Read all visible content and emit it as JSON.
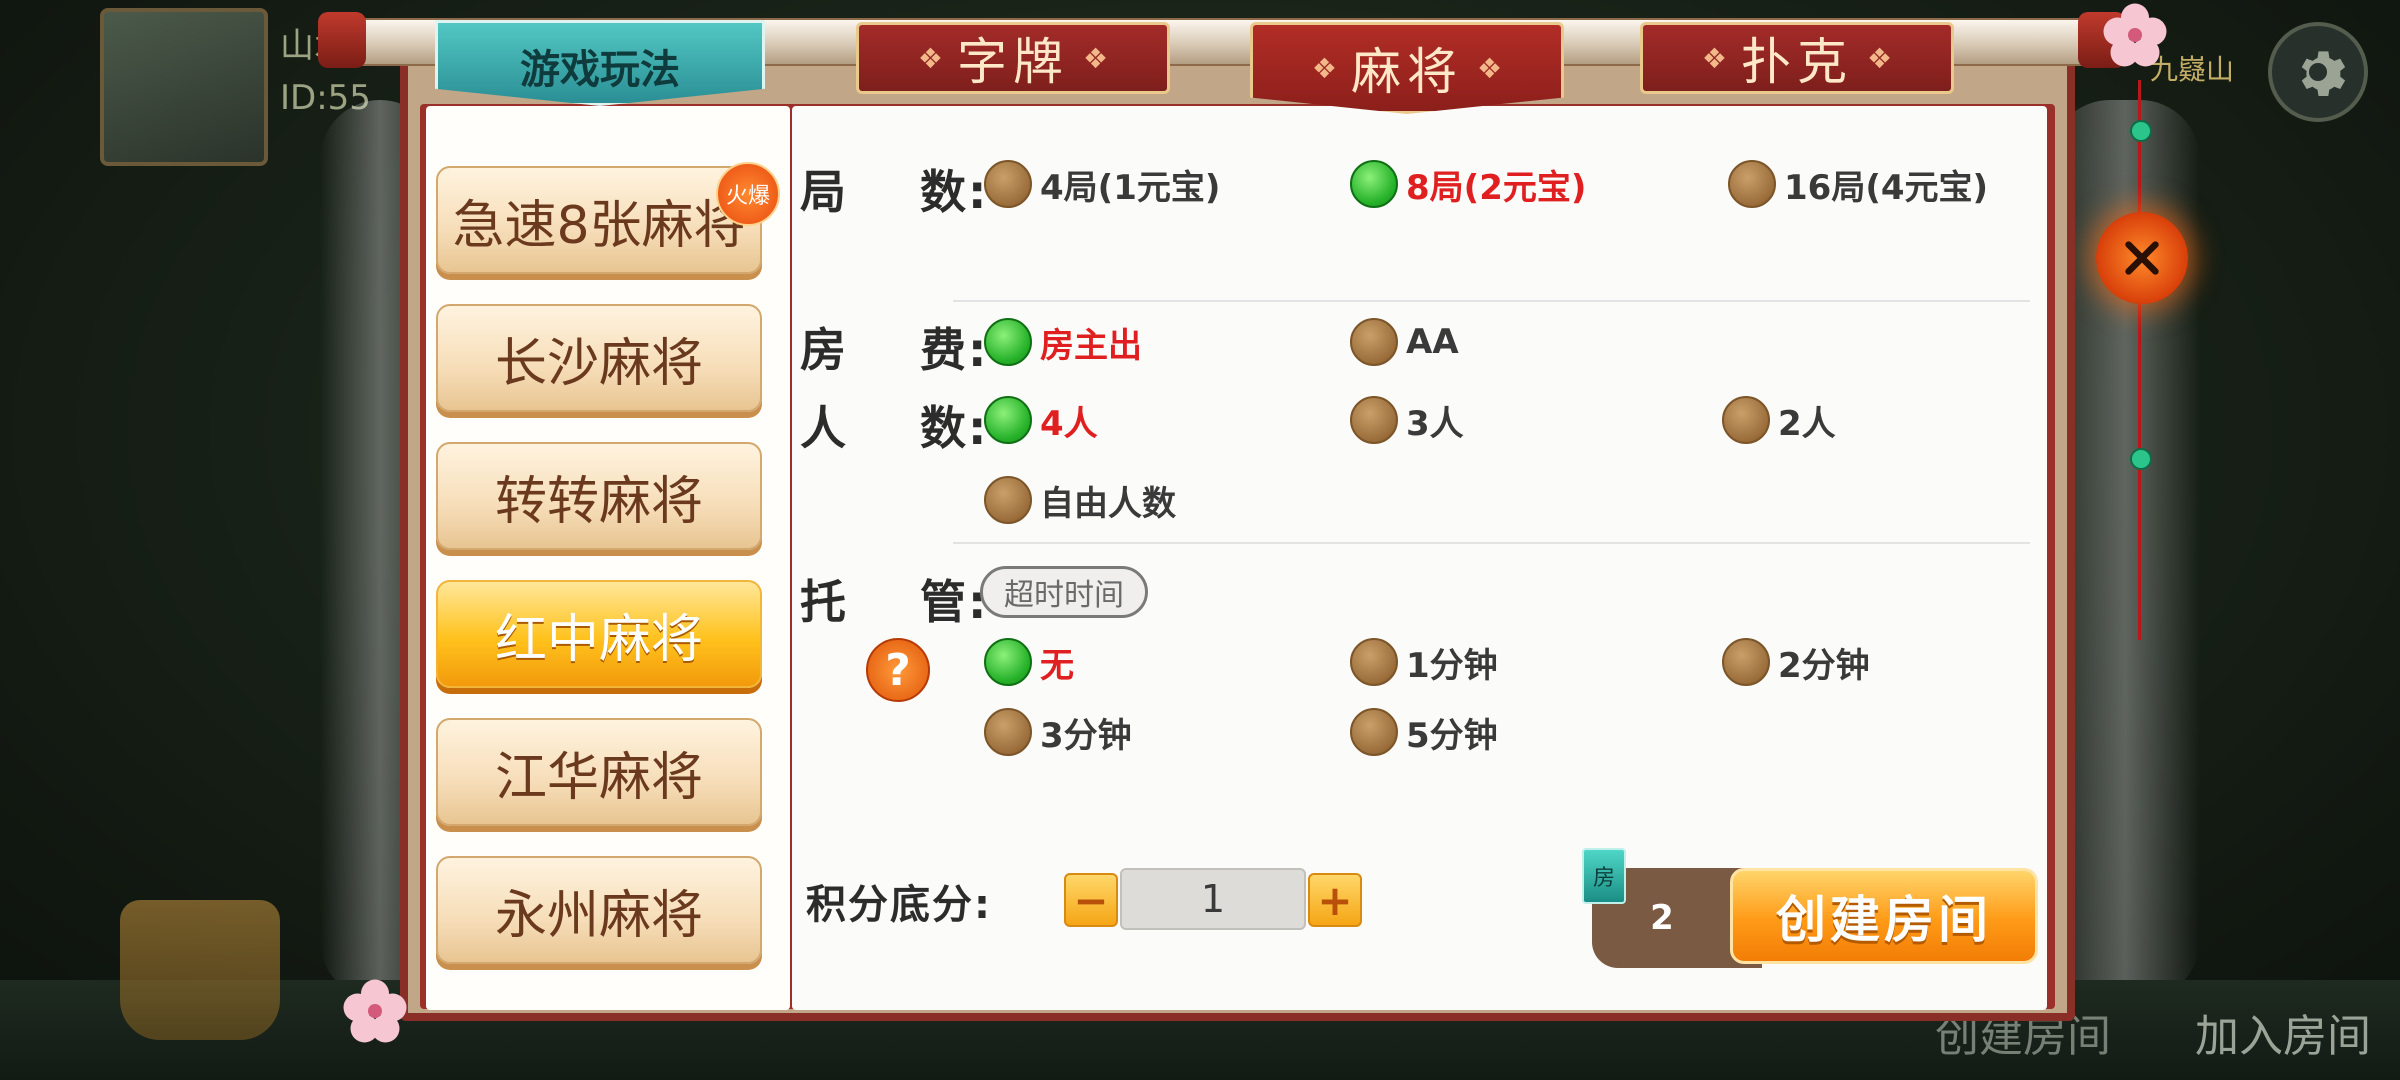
{
  "background": {
    "player_name": "山水",
    "player_id": "ID:55",
    "location": "九嶷山",
    "bottom_create": "创建房间",
    "bottom_join": "加入房间"
  },
  "tabs": {
    "title": "游戏玩法",
    "items": [
      {
        "label": "字牌",
        "active": false
      },
      {
        "label": "麻将",
        "active": true
      },
      {
        "label": "扑克",
        "active": false
      }
    ]
  },
  "games": {
    "hot_badge": "火爆",
    "items": [
      {
        "label": "急速8张麻将",
        "selected": false
      },
      {
        "label": "长沙麻将",
        "selected": false
      },
      {
        "label": "转转麻将",
        "selected": false
      },
      {
        "label": "红中麻将",
        "selected": true
      },
      {
        "label": "江华麻将",
        "selected": false
      },
      {
        "label": "永州麻将",
        "selected": false
      }
    ]
  },
  "options": {
    "rounds": {
      "label": "局    数:",
      "choices": [
        {
          "text": "4局(1元宝)",
          "selected": false
        },
        {
          "text": "8局(2元宝)",
          "selected": true
        },
        {
          "text": "16局(4元宝)",
          "selected": false
        }
      ]
    },
    "fee": {
      "label": "房    费:",
      "choices": [
        {
          "text": "房主出",
          "selected": true
        },
        {
          "text": "AA",
          "selected": false
        }
      ]
    },
    "players": {
      "label": "人    数:",
      "choices": [
        {
          "text": "4人",
          "selected": true
        },
        {
          "text": "3人",
          "selected": false
        },
        {
          "text": "2人",
          "selected": false
        },
        {
          "text": "自由人数",
          "selected": false
        }
      ]
    },
    "auto": {
      "label": "托    管:",
      "timeout_pill": "超时时间",
      "help": "?",
      "choices": [
        {
          "text": "无",
          "selected": true
        },
        {
          "text": "1分钟",
          "selected": false
        },
        {
          "text": "2分钟",
          "selected": false
        },
        {
          "text": "3分钟",
          "selected": false
        },
        {
          "text": "5分钟",
          "selected": false
        }
      ]
    }
  },
  "score": {
    "label": "积分底分:",
    "minus": "−",
    "value": "1",
    "plus": "+"
  },
  "create": {
    "card_icon": "房",
    "cost": "2",
    "button": "创建房间"
  },
  "colors": {
    "accent_red": "#8a2e28",
    "selected_text": "#e02020",
    "selected_dot": "#27b22a",
    "create_orange": "#ff9a17"
  }
}
